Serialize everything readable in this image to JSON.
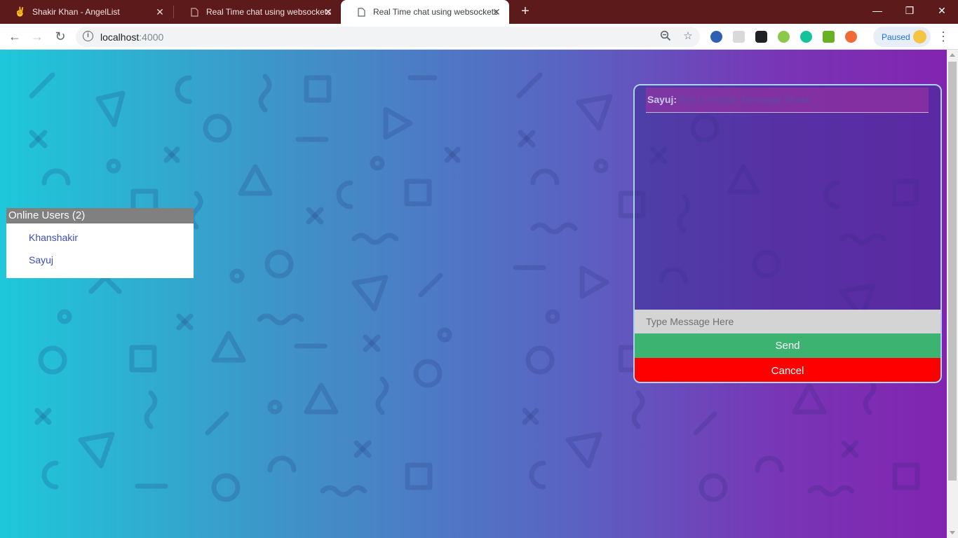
{
  "browser": {
    "tabs": [
      {
        "title": "Shakir Khan - AngelList",
        "icon": "angellist-icon",
        "active": false
      },
      {
        "title": "Real Time chat using websockets",
        "icon": "page-icon",
        "active": false
      },
      {
        "title": "Real Time chat using websockets",
        "icon": "page-icon",
        "active": true
      }
    ],
    "url_host": "localhost",
    "url_port": ":4000",
    "profile_label": "Paused"
  },
  "users_panel": {
    "title": "Online Users (2)",
    "users": [
      "Khanshakir",
      "Sayuj"
    ]
  },
  "chat": {
    "messages": [
      {
        "sender": "Sayuj:",
        "text": "This Is Private Message Shakir"
      }
    ],
    "input_placeholder": "Type Message Here",
    "send_label": "Send",
    "cancel_label": "Cancel"
  },
  "colors": {
    "tabstrip": "#5c1a1b",
    "send_button": "#3cb371",
    "cancel_button": "#ff0000",
    "user_link": "#3d4db7",
    "panel_header": "#808080"
  }
}
